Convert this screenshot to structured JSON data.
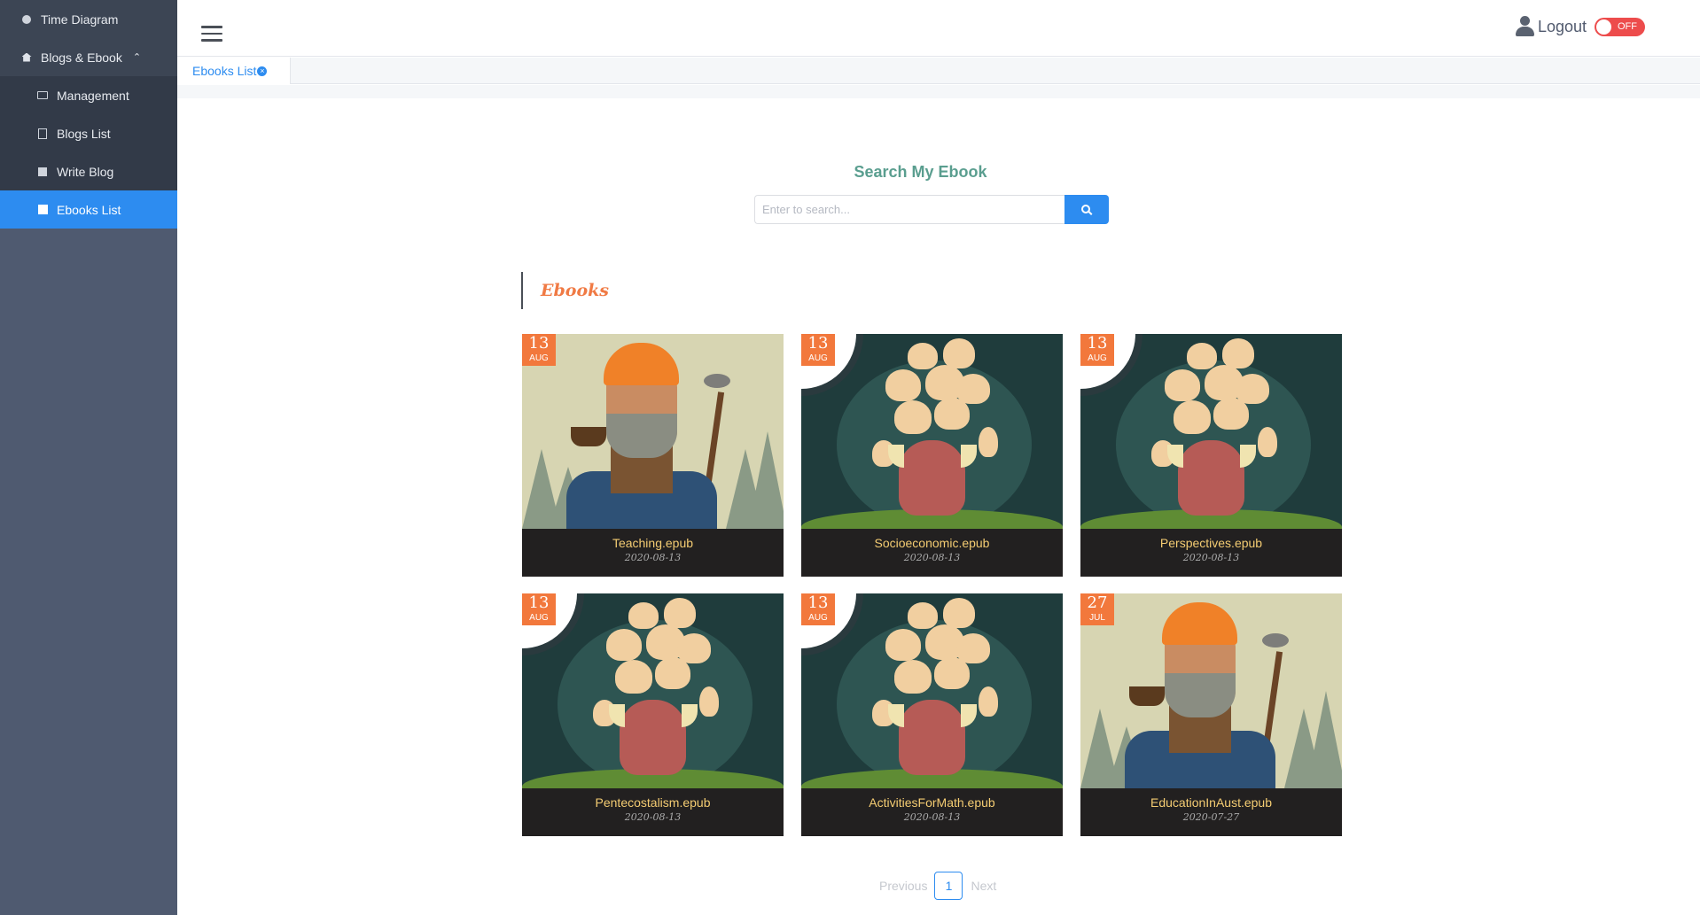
{
  "sidebar": {
    "items": [
      {
        "label": "Time Diagram",
        "icon": "clock-icon"
      },
      {
        "label": "Blogs & Ebook",
        "icon": "home-icon",
        "expanded": true
      },
      {
        "label": "Management",
        "icon": "folder-icon"
      },
      {
        "label": "Blogs List",
        "icon": "list-icon"
      },
      {
        "label": "Write Blog",
        "icon": "edit-icon"
      },
      {
        "label": "Ebooks List",
        "icon": "book-icon",
        "active": true
      }
    ]
  },
  "header": {
    "logout_label": "Logout",
    "toggle_label": "OFF"
  },
  "tabs": [
    {
      "label": "Ebooks List",
      "active": true
    }
  ],
  "search": {
    "title": "Search My Ebook",
    "placeholder": "Enter to search..."
  },
  "section": {
    "title": "Ebooks"
  },
  "ebooks": [
    {
      "day": "13",
      "month": "AUG",
      "name": "Teaching.epub",
      "date": "2020-08-13",
      "cover": "lumberjack"
    },
    {
      "day": "13",
      "month": "AUG",
      "name": "Socioeconomic.epub",
      "date": "2020-08-13",
      "cover": "monster"
    },
    {
      "day": "13",
      "month": "AUG",
      "name": "Perspectives.epub",
      "date": "2020-08-13",
      "cover": "monster"
    },
    {
      "day": "13",
      "month": "AUG",
      "name": "Pentecostalism.epub",
      "date": "2020-08-13",
      "cover": "monster"
    },
    {
      "day": "13",
      "month": "AUG",
      "name": "ActivitiesForMath.epub",
      "date": "2020-08-13",
      "cover": "monster"
    },
    {
      "day": "27",
      "month": "JUL",
      "name": "EducationInAust.epub",
      "date": "2020-07-27",
      "cover": "lumberjack"
    }
  ],
  "pagination": {
    "previous": "Previous",
    "current": "1",
    "next": "Next"
  },
  "colors": {
    "sidebar_bg": "#4f5a70",
    "accent": "#2d8cf0",
    "badge": "#f2783c",
    "toggle_off": "#ed4c4c"
  }
}
